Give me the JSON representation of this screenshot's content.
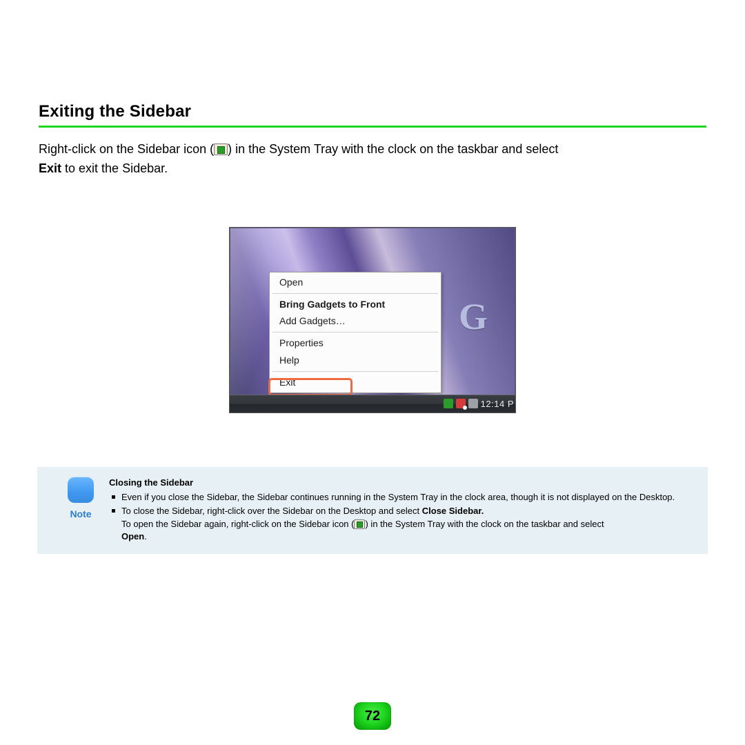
{
  "page": {
    "section_title": "Exiting the Sidebar",
    "body": {
      "part1": "Right-click on the Sidebar icon (",
      "part2": ") in the System Tray with the clock on the taskbar and select",
      "bold_exit": "Exit",
      "part3": " to exit the Sidebar."
    },
    "page_number": "72"
  },
  "screenshot": {
    "logo_fragment": "G",
    "context_menu": {
      "open": "Open",
      "bring_front": "Bring Gadgets to Front",
      "add_gadgets": "Add Gadgets…",
      "properties": "Properties",
      "help": "Help",
      "exit": "Exit"
    },
    "taskbar_clock": "12:14 P"
  },
  "note": {
    "label": "Note",
    "title": "Closing the Sidebar",
    "bullet1": "Even if you close the Sidebar, the Sidebar continues running in the System Tray in the clock area, though it is not displayed on the Desktop.",
    "bullet2_a": "To close the Sidebar, right-click over the Sidebar on the Desktop and select ",
    "bullet2_bold": "Close Sidebar.",
    "sub_a": "To open the Sidebar again, right-click on the Sidebar icon (",
    "sub_b": ") in the System Tray with the clock on the taskbar and select ",
    "sub_bold": "Open",
    "sub_c": "."
  }
}
